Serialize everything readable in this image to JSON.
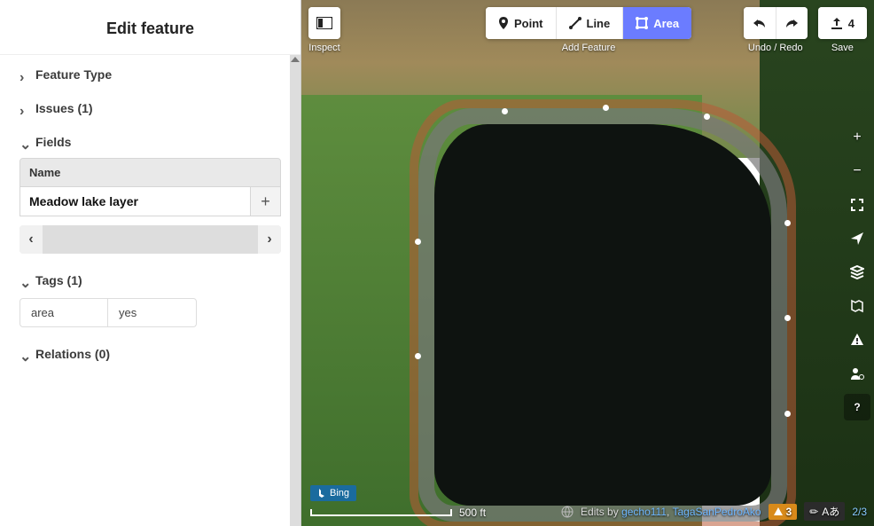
{
  "sidebar": {
    "title": "Edit feature",
    "sections": {
      "feature_type": {
        "label": "Feature Type"
      },
      "issues": {
        "label": "Issues (1)"
      },
      "fields": {
        "label": "Fields",
        "name_label": "Name",
        "name_value": "Meadow lake layer",
        "add_glyph": "+"
      },
      "tags": {
        "label": "Tags (1)",
        "rows": [
          {
            "k": "area",
            "v": "yes"
          }
        ]
      },
      "relations": {
        "label": "Relations (0)"
      }
    }
  },
  "toolbar": {
    "inspect": {
      "caption": "Inspect"
    },
    "add": {
      "caption": "Add Feature",
      "point": "Point",
      "line": "Line",
      "area": "Area"
    },
    "history": {
      "caption": "Undo / Redo"
    },
    "save": {
      "caption": "Save",
      "count": "4"
    }
  },
  "vtools": {
    "zoom_in": "+",
    "zoom_out": "−"
  },
  "footer": {
    "imagery": "Bing",
    "scale": "500 ft",
    "edits_prefix": "Edits by ",
    "editor1": "gecho111",
    "editor_sep": ", ",
    "editor2": "TagaSanPedroAko",
    "warn_count": "3",
    "lang": "Aあ",
    "frac": "2/3"
  }
}
